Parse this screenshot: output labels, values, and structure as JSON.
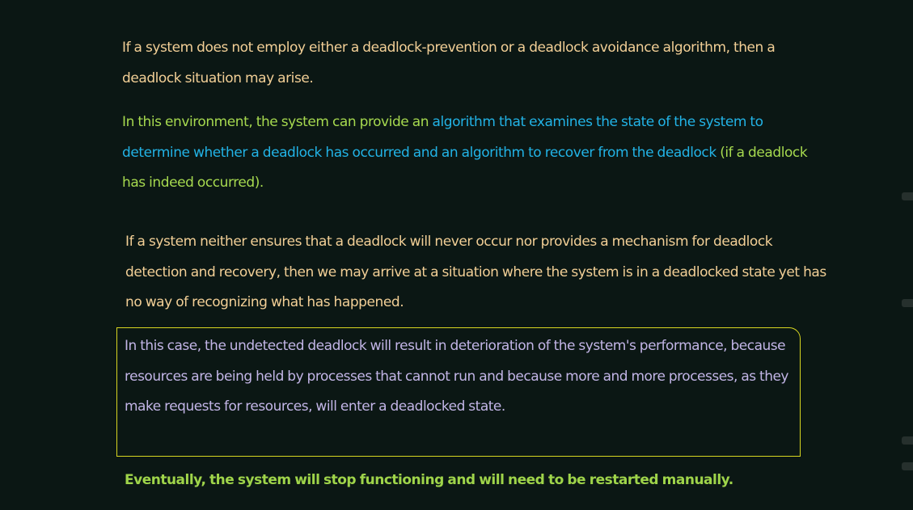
{
  "paragraphs": {
    "p1": "If a system does not employ either a deadlock-prevention or a deadlock avoidance algorithm, then a deadlock situation may arise.",
    "p2_part1": "In this environment, the system can provide an ",
    "p2_highlight": "algorithm that examines the state of the system to determine whether a deadlock has occurred and an algorithm to recover from the deadlock",
    "p2_part2": " (if a deadlock has indeed occurred).",
    "p3": "If a system neither ensures that a deadlock will never occur nor provides a mechanism for deadlock detection and recovery, then we may arrive at a situation where the system is in a deadlocked state yet has no way of recognizing what has happened.",
    "p4": "In this case, the undetected deadlock will result in deterioration of the system's performance, because resources are being held by processes that cannot run and because more and more processes, as they make requests for resources, will enter a deadlocked state.",
    "p5": "Eventually, the system will stop functioning and will need to be restarted manually."
  },
  "colors": {
    "background": "#0b1714",
    "peach_text": "#f2cf96",
    "green_text": "#a6d94f",
    "blue_highlight": "#22b3e6",
    "lavender_text": "#c2b5e6",
    "box_border": "#d8d621"
  }
}
